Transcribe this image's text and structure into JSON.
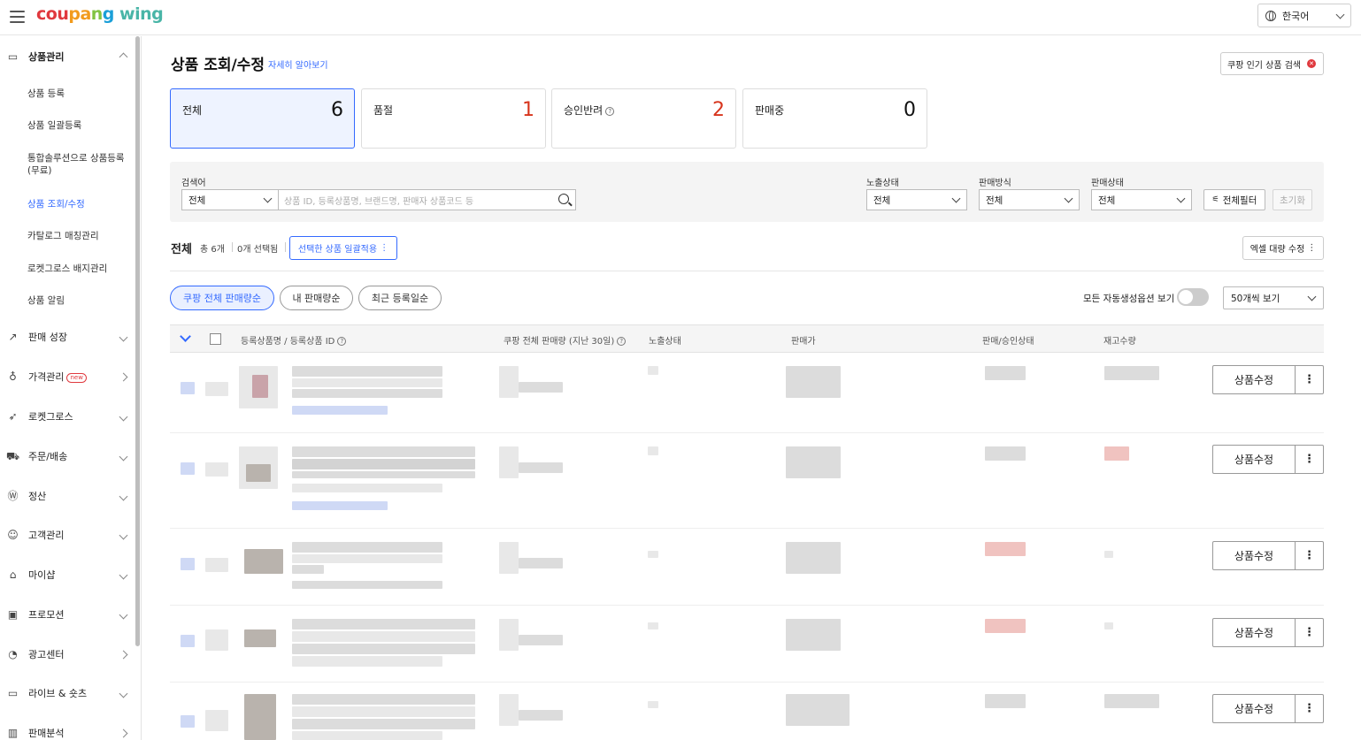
{
  "header": {
    "logo": {
      "part1": "cou",
      "part2": "pa",
      "part3": "n",
      "part4": "g ",
      "part5": "wing"
    },
    "language": "한국어"
  },
  "sidebar": {
    "groups": [
      {
        "label": "상품관리",
        "icon": "box-icon",
        "expanded": true
      },
      {
        "label": "판매 성장",
        "icon": "trend-icon"
      },
      {
        "label": "가격관리",
        "icon": "medal-icon",
        "badge": "new"
      },
      {
        "label": "로켓그로스",
        "icon": "rocket-icon"
      },
      {
        "label": "주문/배송",
        "icon": "truck-icon"
      },
      {
        "label": "정산",
        "icon": "won-icon"
      },
      {
        "label": "고객관리",
        "icon": "smile-icon"
      },
      {
        "label": "마이샵",
        "icon": "shop-icon"
      },
      {
        "label": "프로모션",
        "icon": "promotion-icon"
      },
      {
        "label": "광고센터",
        "icon": "ad-icon"
      },
      {
        "label": "라이브 & 숏츠",
        "icon": "live-icon"
      },
      {
        "label": "판매분석",
        "icon": "chart-icon"
      }
    ],
    "sub_items": [
      {
        "label": "상품 등록"
      },
      {
        "label": "상품 일괄등록"
      },
      {
        "label": "통합솔루션으로 상품등록 (무료)"
      },
      {
        "label": "상품 조회/수정",
        "active": true
      },
      {
        "label": "카탈로그 매칭관리"
      },
      {
        "label": "로켓그로스 배지관리"
      },
      {
        "label": "상품 알림"
      }
    ]
  },
  "page": {
    "title": "상품 조회/수정",
    "learn_more": "자세히 알아보기",
    "hot_search": "쿠팡 인기 상품 검색"
  },
  "stats": [
    {
      "label": "전체",
      "value": "6"
    },
    {
      "label": "품절",
      "value": "1"
    },
    {
      "label": "승인반려",
      "value": "2"
    },
    {
      "label": "판매중",
      "value": "0"
    }
  ],
  "filters": {
    "search_label": "검색어",
    "search_scope": "전체",
    "search_placeholder": "상품 ID, 등록상품명, 브랜드명, 판매자 상품코드 등",
    "exposure_label": "노출상태",
    "exposure_value": "전체",
    "method_label": "판매방식",
    "method_value": "전체",
    "status_label": "판매상태",
    "status_value": "전체",
    "all_filter": "전체필터",
    "reset": "초기화"
  },
  "list": {
    "title": "전체",
    "total": "총 6개",
    "selected": "0개 선택됨",
    "bulk_apply": "선택한 상품 일괄적용",
    "excel_edit": "엑셀 대량 수정"
  },
  "sort": {
    "options": [
      "쿠팡 전체 판매량순",
      "내 판매량순",
      "최근 등록일순"
    ],
    "auto_option_label": "모든 자동생성옵션 보기",
    "per_page": "50개씩 보기"
  },
  "table": {
    "columns": [
      "등록상품명 / 등록상품 ID",
      "쿠팡 전체 판매량 (지난 30일)",
      "노출상태",
      "판매가",
      "판매/승인상태",
      "재고수량"
    ],
    "edit_label": "상품수정",
    "more_label": "⋮"
  },
  "colors": {
    "accent": "#346aff",
    "red": "#d7341c"
  }
}
